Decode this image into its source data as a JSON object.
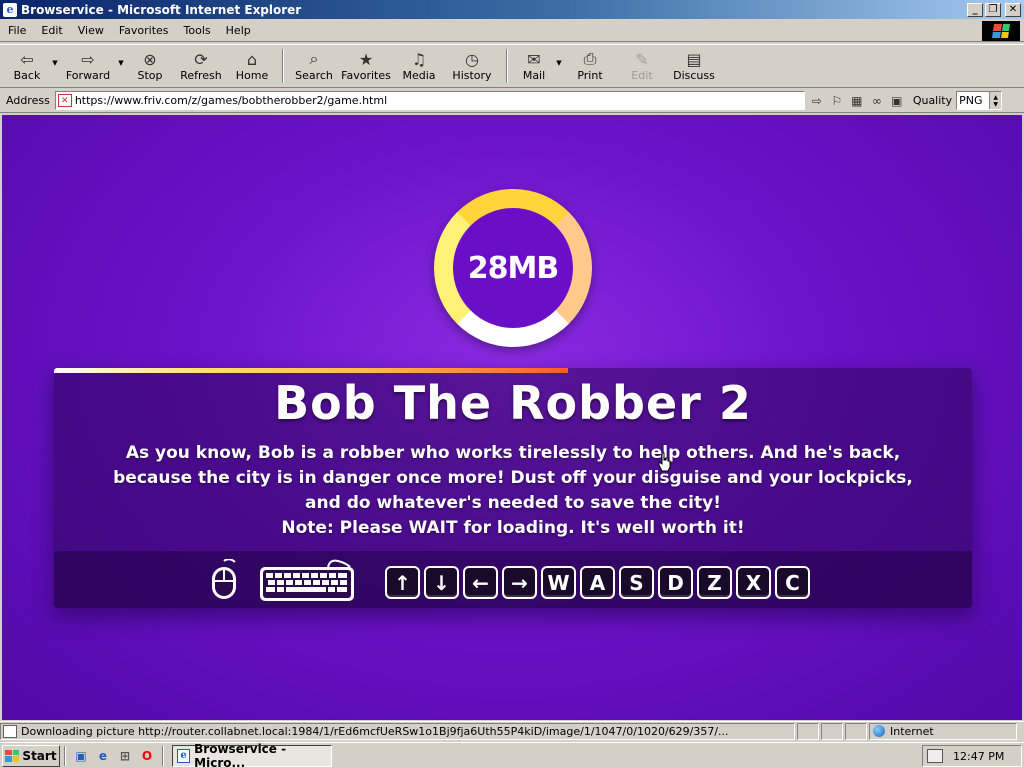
{
  "window": {
    "title": "Browservice - Microsoft Internet Explorer",
    "minimize_label": "_",
    "maximize_label": "❐",
    "close_label": "✕"
  },
  "menu": {
    "items": [
      {
        "id": "file",
        "label": "File"
      },
      {
        "id": "edit",
        "label": "Edit"
      },
      {
        "id": "view",
        "label": "View"
      },
      {
        "id": "favorites",
        "label": "Favorites"
      },
      {
        "id": "tools",
        "label": "Tools"
      },
      {
        "id": "help",
        "label": "Help"
      }
    ]
  },
  "toolbar": {
    "back": {
      "label": "Back",
      "icon": "back-arrow-icon"
    },
    "forward": {
      "label": "Forward",
      "icon": "forward-arrow-icon"
    },
    "stop": {
      "label": "Stop",
      "icon": "stop-icon"
    },
    "refresh": {
      "label": "Refresh",
      "icon": "refresh-icon"
    },
    "home": {
      "label": "Home",
      "icon": "home-icon"
    },
    "search": {
      "label": "Search",
      "icon": "search-icon"
    },
    "favorites": {
      "label": "Favorites",
      "icon": "favorites-icon"
    },
    "media": {
      "label": "Media",
      "icon": "media-icon"
    },
    "history": {
      "label": "History",
      "icon": "history-icon"
    },
    "mail": {
      "label": "Mail",
      "icon": "mail-icon"
    },
    "print": {
      "label": "Print",
      "icon": "print-icon"
    },
    "edit": {
      "label": "Edit",
      "icon": "edit-icon",
      "disabled": true
    },
    "discuss": {
      "label": "Discuss",
      "icon": "discuss-icon"
    }
  },
  "address": {
    "label": "Address",
    "url": "https://www.friv.com/z/games/bobtherobber2/game.html",
    "quality_label": "Quality",
    "quality_value": "PNG"
  },
  "page": {
    "size_badge": "28MB",
    "loading_progress": 0.56,
    "title": "Bob The Robber 2",
    "description_lines": [
      "As you know, Bob is a robber who works tirelessly to help others. And he's back,",
      "because the city is in danger once more! Dust off your disguise and your lockpicks,",
      "and do whatever's needed to save the city!",
      "Note: Please WAIT for loading. It's well worth it!"
    ],
    "control_keys": [
      "↑",
      "↓",
      "←",
      "→",
      "W",
      "A",
      "S",
      "D",
      "Z",
      "X",
      "C"
    ]
  },
  "status": {
    "text": "Downloading picture http://router.collabnet.local:1984/1/rEd6mcfUeRSw1o1Bj9fja6Uth55P4kiD/image/1/1047/0/1020/629/357/...",
    "zone": "Internet"
  },
  "taskbar": {
    "start_label": "Start",
    "task_label": "Browservice - Micro...",
    "clock": "12:47 PM"
  },
  "colors": {
    "page_background": "#6a12c8",
    "titlebar": "#0a246a",
    "accent_yellow": "#ffd43b"
  }
}
